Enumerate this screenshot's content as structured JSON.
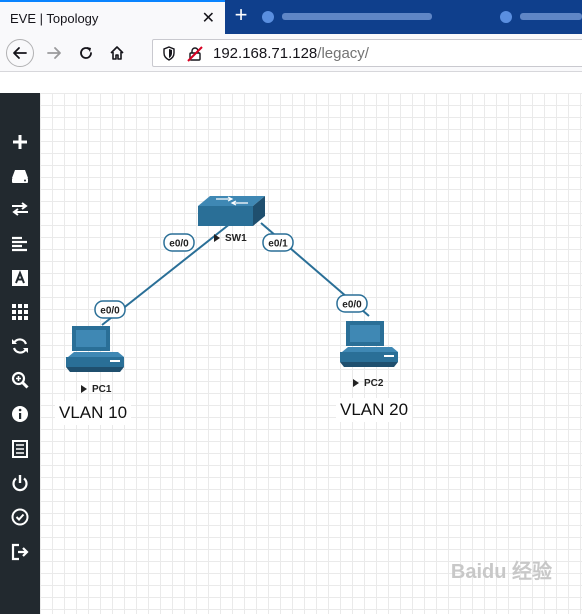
{
  "browser": {
    "tab_title": "EVE | Topology",
    "tab_close_glyph": "✕",
    "new_tab_glyph": "+",
    "url_host": "192.168.71.128",
    "url_path": "/legacy/"
  },
  "sidebar": {
    "items": [
      {
        "icon": "plus-icon",
        "action": "add-object"
      },
      {
        "icon": "drive-icon",
        "action": "nodes"
      },
      {
        "icon": "arrows-icon",
        "action": "networks"
      },
      {
        "icon": "align-left-icon",
        "action": "startup-configs"
      },
      {
        "icon": "text-icon",
        "action": "text-objects"
      },
      {
        "icon": "grid-icon",
        "action": "status"
      },
      {
        "icon": "refresh-icon",
        "action": "refresh"
      },
      {
        "icon": "zoom-icon",
        "action": "zoom"
      },
      {
        "icon": "info-icon",
        "action": "lab-details"
      },
      {
        "icon": "list-icon",
        "action": "lab-list"
      },
      {
        "icon": "power-icon",
        "action": "close-lab"
      },
      {
        "icon": "check-icon",
        "action": "lock-lab"
      },
      {
        "icon": "logout-icon",
        "action": "logout"
      }
    ]
  },
  "topology": {
    "nodes": {
      "sw1": {
        "label": "SW1",
        "type": "switch"
      },
      "pc1": {
        "label": "PC1",
        "type": "pc"
      },
      "pc2": {
        "label": "PC2",
        "type": "pc"
      }
    },
    "interfaces": {
      "sw1_to_pc1": "e0/0",
      "sw1_to_pc2": "e0/1",
      "pc1": "e0/0",
      "pc2": "e0/0"
    },
    "text_objects": {
      "vlan_pc1": "VLAN 10",
      "vlan_pc2": "VLAN 20"
    },
    "colors": {
      "device": "#2a6f97",
      "device_dark": "#1f4f6e",
      "link": "#2a6f97"
    }
  },
  "watermark": "Baidu 经验"
}
